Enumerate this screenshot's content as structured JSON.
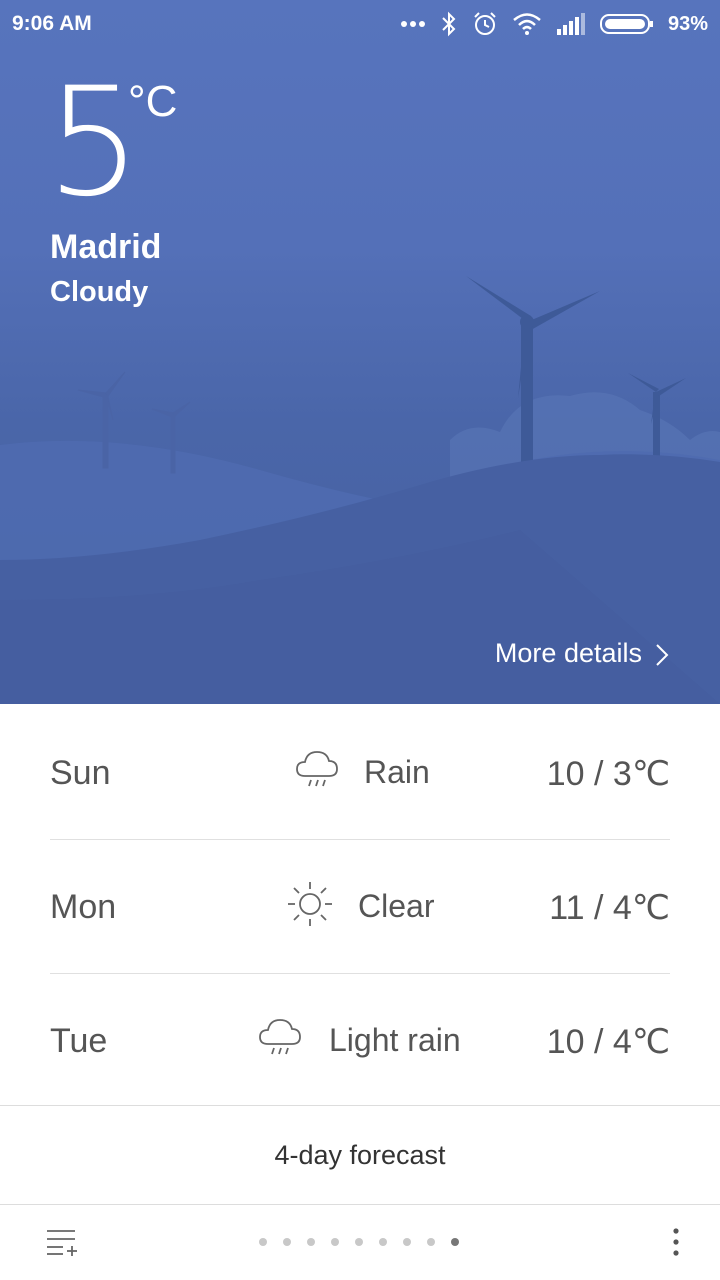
{
  "status_bar": {
    "time": "9:06 AM",
    "battery_percent": "93%",
    "icons": [
      "more-dots-icon",
      "bluetooth-icon",
      "alarm-icon",
      "wifi-icon",
      "signal-icon",
      "battery-icon"
    ]
  },
  "current": {
    "temperature": "5",
    "unit": "°C",
    "city": "Madrid",
    "condition": "Cloudy",
    "more_details": "More details"
  },
  "forecast": [
    {
      "day": "Sun",
      "icon": "rain-cloud-icon",
      "condition": "Rain",
      "range": "10 / 3℃"
    },
    {
      "day": "Mon",
      "icon": "sun-icon",
      "condition": "Clear",
      "range": "11 / 4℃"
    },
    {
      "day": "Tue",
      "icon": "rain-cloud-icon",
      "condition": "Light rain",
      "range": "10 / 4℃"
    }
  ],
  "forecast_button": "4-day forecast",
  "bottom_bar": {
    "pages_total": 9,
    "active_page_index": 8
  },
  "colors": {
    "hero_top": "#5774bd",
    "hero_bottom": "#455f9e",
    "text_gray": "#555555"
  }
}
